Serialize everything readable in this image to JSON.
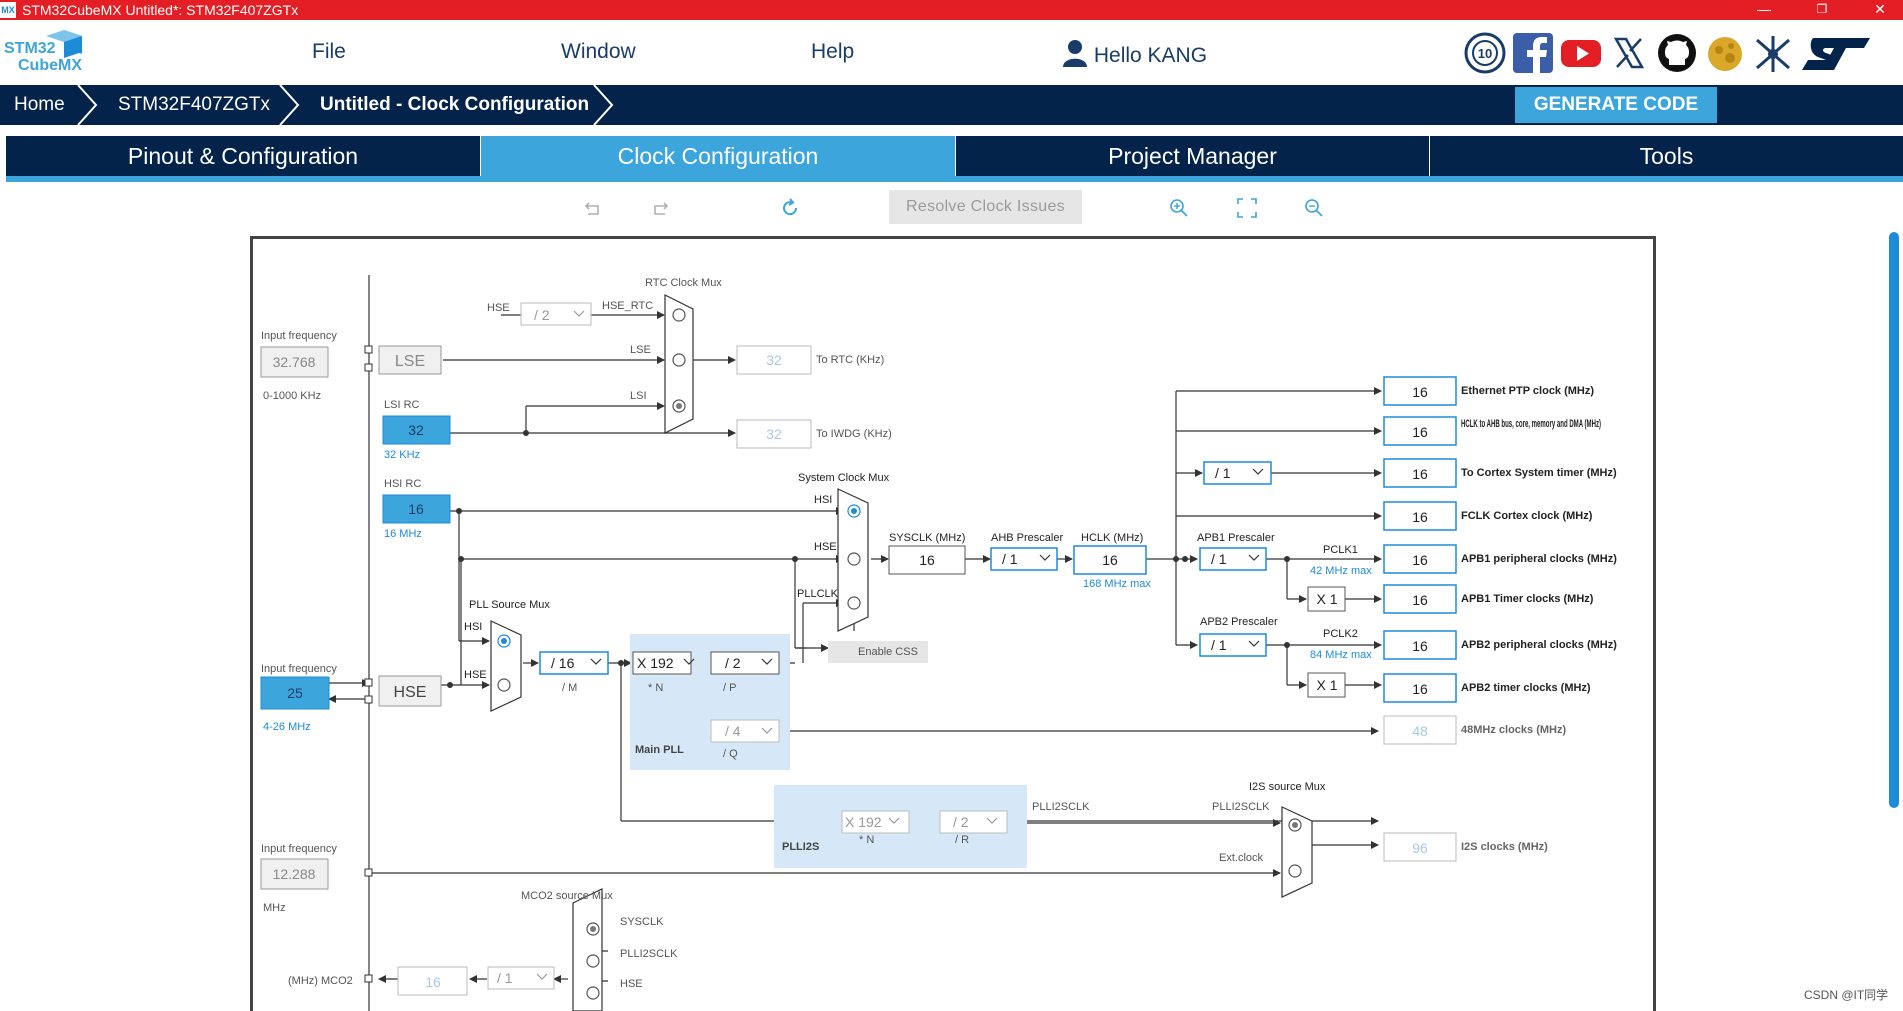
{
  "window": {
    "app_icon": "MX",
    "title": "STM32CubeMX Untitled*: STM32F407ZGTx",
    "minimize": "—",
    "restore": "❐",
    "close": "✕"
  },
  "logo": {
    "line1": "STM32",
    "line2": "CubeMX"
  },
  "menu": {
    "file": "File",
    "window": "Window",
    "help": "Help",
    "user": "Hello KANG"
  },
  "social_icons": [
    "10-year-anniversary-icon",
    "facebook-icon",
    "youtube-icon",
    "x-icon",
    "github-icon",
    "community-icon",
    "network-icon",
    "st-logo-icon"
  ],
  "breadcrumb": {
    "home": "Home",
    "device": "STM32F407ZGTx",
    "current": "Untitled - Clock Configuration"
  },
  "generate_code": "GENERATE CODE",
  "tabs": [
    "Pinout & Configuration",
    "Clock Configuration",
    "Project Manager",
    "Tools"
  ],
  "active_tab": "Clock Configuration",
  "toolbar": {
    "resolve": "Resolve Clock Issues",
    "icons": [
      "undo-icon",
      "redo-icon",
      "refresh-icon",
      "zoom-in-icon",
      "fit-screen-icon",
      "zoom-out-icon"
    ]
  },
  "colors": {
    "titlebar": "#e31e24",
    "navy": "#03234b",
    "accent": "#3ca5dc",
    "box_border": "#1d8bd8",
    "pll_fill": "#d6e8f7"
  },
  "clock": {
    "rtc_mux": "RTC Clock Mux",
    "hse": "HSE",
    "div2": "/ 2",
    "hse_rtc": "HSE_RTC",
    "input_freq": "Input frequency",
    "lse_value": "32.768",
    "lse_range": "0-1000 KHz",
    "lse": "LSE",
    "lse_lbl": "LSE",
    "lsi_rc": "LSI RC",
    "lsi_value": "32",
    "lsi_khz": "32 KHz",
    "lsi_lbl": "LSI",
    "to_rtc_value": "32",
    "to_rtc": "To RTC (KHz)",
    "to_iwdg_value": "32",
    "to_iwdg": "To IWDG (KHz)",
    "hsi_rc": "HSI RC",
    "hsi_value": "16",
    "hsi_mhz": "16 MHz",
    "sys_mux": "System Clock Mux",
    "hsi_lbl": "HSI",
    "hse_lbl": "HSE",
    "pllclk_lbl": "PLLCLK",
    "sysclk_label": "SYSCLK (MHz)",
    "sysclk_value": "16",
    "ahb_label": "AHB Prescaler",
    "ahb_value": "/ 1",
    "hclk_label": "HCLK (MHz)",
    "hclk_value": "16",
    "hclk_max": "168 MHz max",
    "enable_css": "Enable CSS",
    "pll_src_mux": "PLL Source Mux",
    "pll_hsi": "HSI",
    "pll_hse": "HSE",
    "hse_input_label": "Input frequency",
    "hse_value": "25",
    "hse_range": "4-26 MHz",
    "hse_box": "HSE",
    "pllm_value": "/ 16",
    "pllm_lbl": "/ M",
    "plln_value": "X 192",
    "plln_lbl": "* N",
    "pllp_value": "/ 2",
    "pllp_lbl": "/ P",
    "pllq_value": "/ 4",
    "pllq_lbl": "/ Q",
    "main_pll": "Main PLL",
    "plli2s_n_value": "X 192",
    "plli2s_n_lbl": "* N",
    "plli2s_r_value": "/ 2",
    "plli2s_r_lbl": "/ R",
    "plli2s": "PLLI2S",
    "plli2sclk": "PLLI2SCLK",
    "i2s_mux": "I2S source Mux",
    "i2s_plli2sclk": "PLLI2SCLK",
    "ext_clock": "Ext.clock",
    "i2s_value": "96",
    "i2s_label": "I2S clocks (MHz)",
    "ext_input_label": "Input frequency",
    "ext_value": "12.288",
    "ext_unit": "MHz",
    "mco2_mux": "MCO2 source Mux",
    "mco2_sysclk": "SYSCLK",
    "mco2_plli2sclk": "PLLI2SCLK",
    "mco2_hse": "HSE",
    "mco2_label": "(MHz) MCO2",
    "mco2_value": "16",
    "mco2_div": "/ 1",
    "apb1_prescaler": "APB1 Prescaler",
    "apb1_value": "/ 1",
    "pclk1": "PCLK1",
    "pclk1_max": "42 MHz max",
    "apb2_prescaler": "APB2 Prescaler",
    "apb2_value": "/ 1",
    "pclk2": "PCLK2",
    "pclk2_max": "84 MHz max",
    "cortex_div": "/ 1",
    "x1_a": "X 1",
    "x1_b": "X 1",
    "outputs": [
      {
        "value": "16",
        "label": "Ethernet PTP clock (MHz)"
      },
      {
        "value": "16",
        "label": "HCLK to AHB bus, core, memory and DMA (MHz)"
      },
      {
        "value": "16",
        "label": "To Cortex System timer (MHz)"
      },
      {
        "value": "16",
        "label": "FCLK Cortex clock (MHz)"
      },
      {
        "value": "16",
        "label": "APB1 peripheral clocks (MHz)"
      },
      {
        "value": "16",
        "label": "APB1 Timer clocks (MHz)"
      },
      {
        "value": "16",
        "label": "APB2 peripheral clocks (MHz)"
      },
      {
        "value": "16",
        "label": "APB2 timer clocks (MHz)"
      },
      {
        "value": "48",
        "label": "48MHz clocks (MHz)"
      }
    ]
  },
  "watermark": "CSDN @IT同学"
}
